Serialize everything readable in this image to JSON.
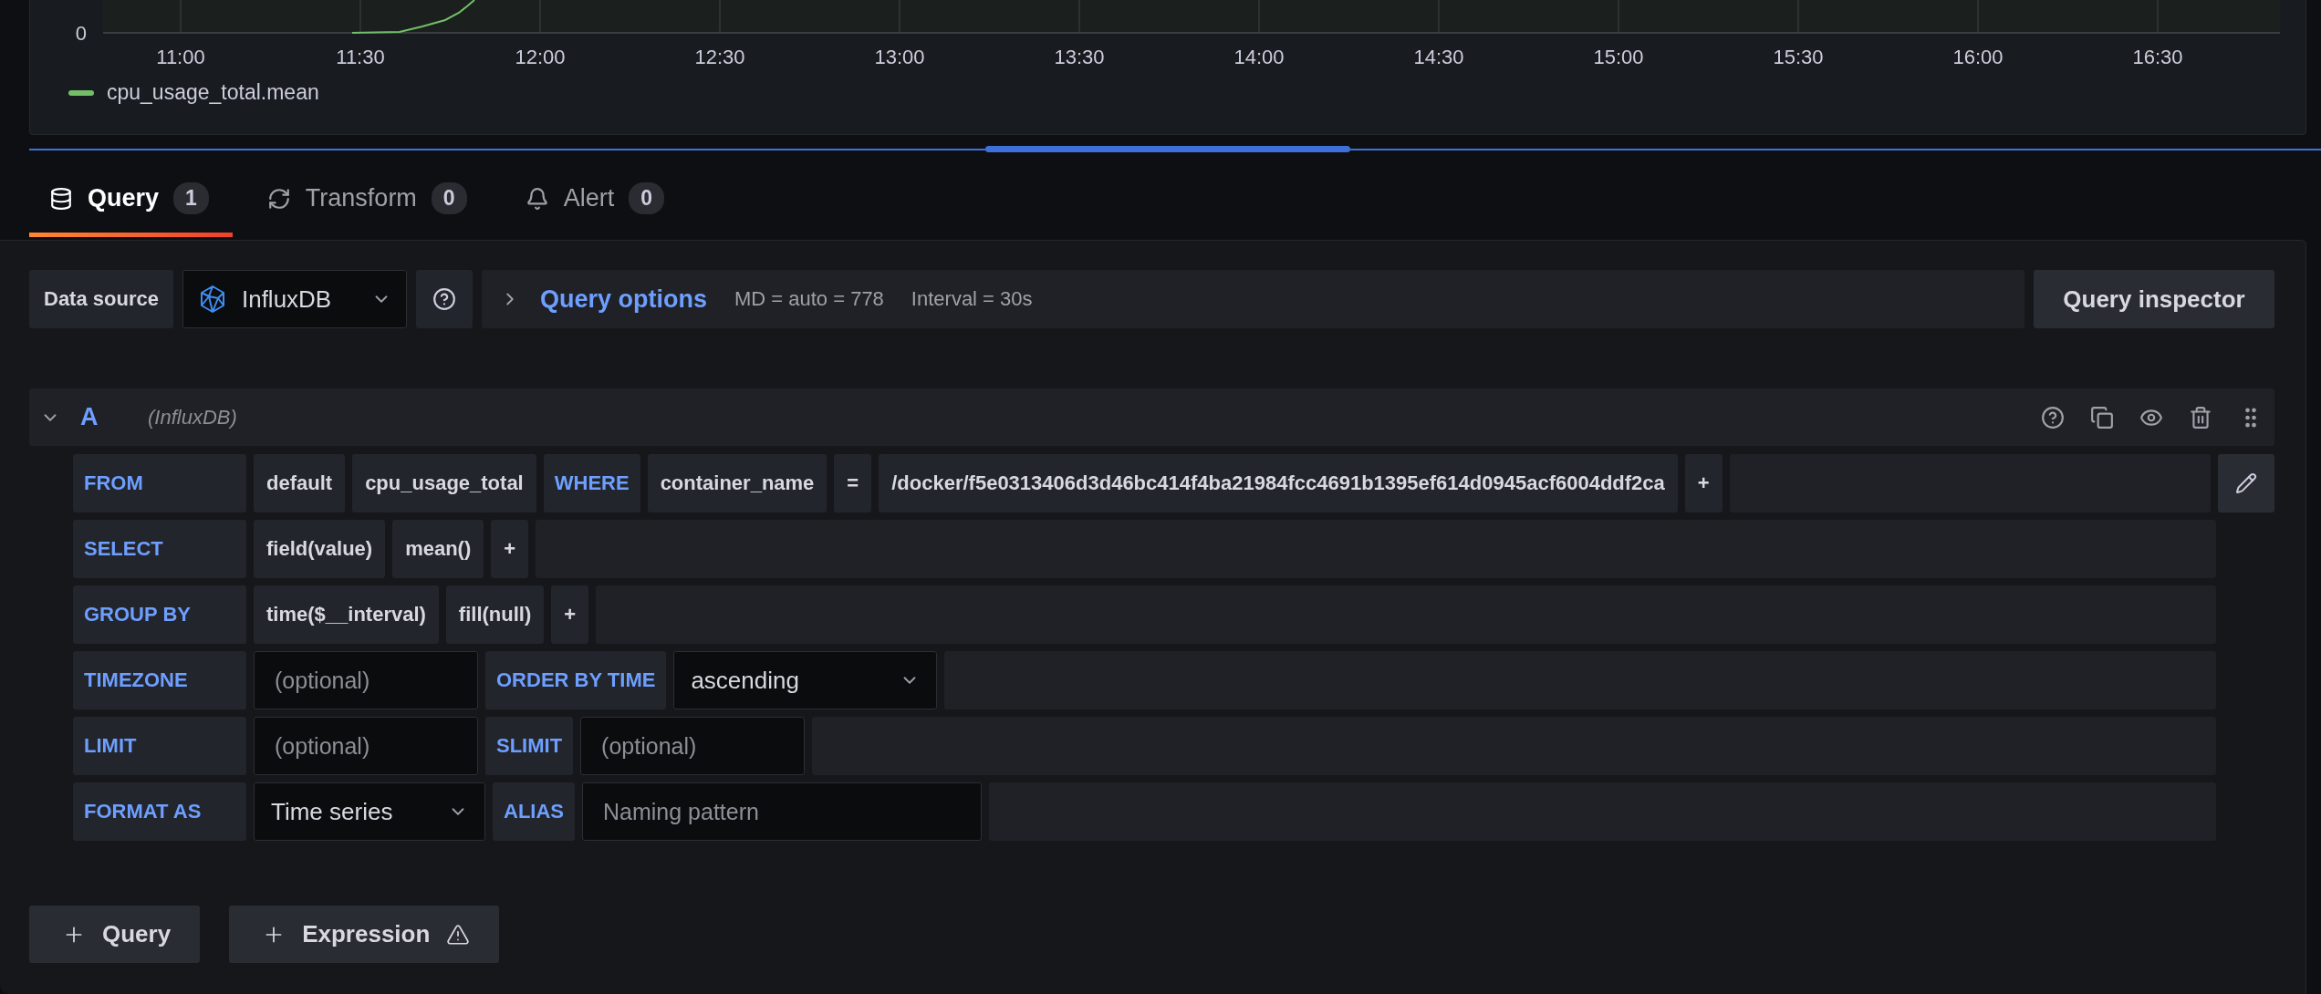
{
  "chart": {
    "y_tick": "0",
    "x_ticks": [
      "11:00",
      "11:30",
      "12:00",
      "12:30",
      "13:00",
      "13:30",
      "14:00",
      "14:30",
      "15:00",
      "15:30",
      "16:00",
      "16:30"
    ],
    "legend": [
      {
        "name": "cpu_usage_total.mean",
        "color": "#73bf69"
      }
    ]
  },
  "tabs": [
    {
      "label": "Query",
      "count": "1",
      "selected": true
    },
    {
      "label": "Transform",
      "count": "0",
      "selected": false
    },
    {
      "label": "Alert",
      "count": "0",
      "selected": false
    }
  ],
  "data_source_bar": {
    "label": "Data source",
    "datasource": "InfluxDB",
    "query_options": "Query options",
    "expanded": false,
    "max_data_points": "MD = auto = 778",
    "interval": "Interval = 30s",
    "inspector": "Query inspector"
  },
  "query": {
    "ref": "A",
    "datasource": "(InfluxDB)",
    "expanded": true,
    "rows": [
      {
        "label": "FROM",
        "parts": [
          {
            "kind": "segment",
            "text": "default"
          },
          {
            "kind": "segment",
            "text": "cpu_usage_total"
          },
          {
            "kind": "keyword",
            "text": "WHERE"
          },
          {
            "kind": "segment",
            "text": "container_name"
          },
          {
            "kind": "segment",
            "text": "="
          },
          {
            "kind": "segment",
            "text": "/docker/f5e0313406d3d46bc414f4ba21984fcc4691b1395ef614d0945acf6004ddf2ca"
          },
          {
            "kind": "add",
            "text": "+"
          },
          {
            "kind": "edit"
          }
        ]
      },
      {
        "label": "SELECT",
        "parts": [
          {
            "kind": "segment",
            "text": "field(value)"
          },
          {
            "kind": "segment",
            "text": "mean()"
          },
          {
            "kind": "add",
            "text": "+"
          }
        ]
      },
      {
        "label": "GROUP BY",
        "parts": [
          {
            "kind": "segment",
            "text": "time($__interval)"
          },
          {
            "kind": "segment",
            "text": "fill(null)"
          },
          {
            "kind": "add",
            "text": "+"
          }
        ]
      },
      {
        "label": "TIMEZONE",
        "parts": [
          {
            "kind": "input",
            "placeholder": "(optional)"
          },
          {
            "kind": "keyword",
            "text": "ORDER BY TIME"
          },
          {
            "kind": "select",
            "text": "ascending"
          }
        ]
      },
      {
        "label": "LIMIT",
        "parts": [
          {
            "kind": "input",
            "placeholder": "(optional)"
          },
          {
            "kind": "keyword",
            "text": "SLIMIT"
          },
          {
            "kind": "input",
            "placeholder": "(optional)"
          }
        ]
      },
      {
        "label": "FORMAT AS",
        "parts": [
          {
            "kind": "short_select",
            "text": "Time series"
          },
          {
            "kind": "keyword",
            "text": "ALIAS"
          },
          {
            "kind": "wide_input",
            "placeholder": "Naming pattern"
          }
        ]
      }
    ]
  },
  "buttons": [
    {
      "label": "Query",
      "warning": false
    },
    {
      "label": "Expression",
      "warning": true
    }
  ]
}
